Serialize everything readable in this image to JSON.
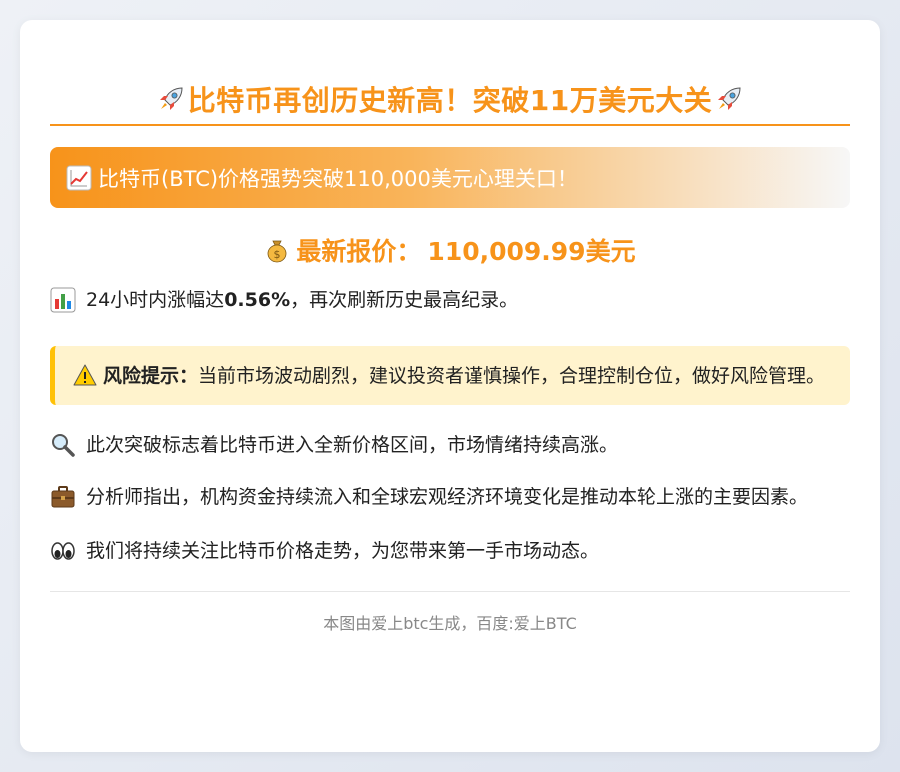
{
  "header": {
    "title": "比特币再创历史新高！突破11万美元大关",
    "left_icon": "rocket-icon",
    "right_icon": "rocket-icon"
  },
  "banner": {
    "icon": "chart-increasing-icon",
    "text": "比特币(BTC)价格强势突破110,000美元心理关口！"
  },
  "price": {
    "icon": "money-bag-icon",
    "label": "最新报价：",
    "value": "110,009.99美元"
  },
  "change": {
    "icon": "bar-chart-icon",
    "prefix": "24小时内涨幅达",
    "percent": "0.56%",
    "suffix": "，再次刷新历史最高纪录。"
  },
  "warning": {
    "icon": "warning-icon",
    "label": "风险提示：",
    "text": "当前市场波动剧烈，建议投资者谨慎操作，合理控制仓位，做好风险管理。"
  },
  "paragraphs": [
    {
      "icon": "magnifier-icon",
      "text": "此次突破标志着比特币进入全新价格区间，市场情绪持续高涨。"
    },
    {
      "icon": "briefcase-icon",
      "text": "分析师指出，机构资金持续流入和全球宏观经济环境变化是推动本轮上涨的主要因素。"
    },
    {
      "icon": "eyes-icon",
      "text": "我们将持续关注比特币价格走势，为您带来第一手市场动态。"
    }
  ],
  "footer": {
    "text": "本图由爱上btc生成，百度:爱上BTC"
  },
  "colors": {
    "accent": "#f7931a",
    "warning_bg": "#fff3cd",
    "warning_border": "#ffc107"
  }
}
